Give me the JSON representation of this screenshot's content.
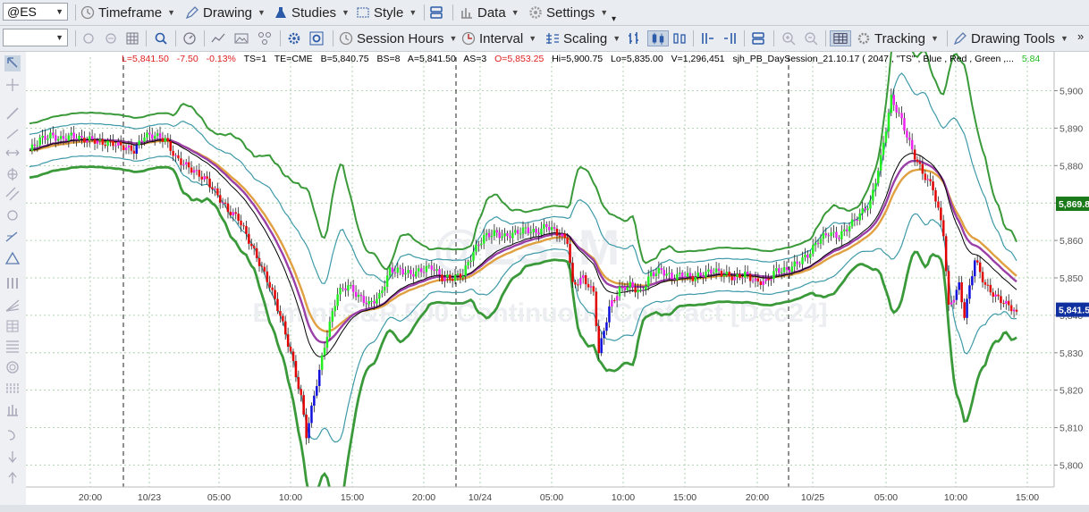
{
  "toolbar1": {
    "symbol": "@ES",
    "timeframe": "Timeframe",
    "drawing": "Drawing",
    "studies": "Studies",
    "style": "Style",
    "data": "Data",
    "settings": "Settings"
  },
  "toolbar2": {
    "combo_value": "",
    "session_hours": "Session Hours",
    "interval": "Interval",
    "scaling": "Scaling",
    "tracking": "Tracking",
    "drawing_tools": "Drawing Tools",
    "overflow": "»"
  },
  "status": {
    "last": "L=5,841.50",
    "change": "-7.50",
    "pct": "-0.13%",
    "ts": "TS=1",
    "te": "TE=CME",
    "bid": "B=5,840.75",
    "bs": "BS=8",
    "ask": "A=5,841.50",
    "as": "AS=3",
    "open": "O=5,853.25",
    "hi": "Hi=5,900.75",
    "lo": "Lo=5,835.00",
    "vol": "V=1,296,451",
    "study": "sjh_PB_DaySession_21.10.17 ( 2047 , \"TS\" , Blue , Red , Green ,...",
    "trail": "5.84"
  },
  "watermark": {
    "symbol": "@ES=M",
    "desc": "E-mini S&P 500 Continuous Contract [Dec24]"
  },
  "price_axis": {
    "ticks": [
      "5,900",
      "5,890",
      "5,880",
      "5,870",
      "5,860",
      "5,850",
      "5,840",
      "5,830",
      "5,820",
      "5,810",
      "5,800"
    ],
    "marker_green": "5,869.8",
    "marker_blue": "5,841.5"
  },
  "time_axis": {
    "labels": [
      "20:00",
      "10/23",
      "05:00",
      "10:00",
      "15:00",
      "20:00",
      "10/24",
      "05:00",
      "10:00",
      "15:00",
      "20:00",
      "10/25",
      "05:00",
      "10:00",
      "15:00"
    ]
  },
  "colors": {
    "up": "#22ee22",
    "down": "#ee1111",
    "strong_up": "#1010dd",
    "strong_down": "#e00000",
    "pullback": "#ee22ee",
    "band_outer": "#3a9a3a",
    "band_inner": "#3e9aa8",
    "avg_purple": "#9a3ea8",
    "avg_orange": "#e0a040",
    "avg_black": "#000000",
    "marker_green": "#1a7a1a",
    "marker_blue": "#1030a0"
  },
  "chart_data": {
    "type": "candlestick",
    "symbol": "@ES",
    "ylim": [
      5797,
      5907
    ],
    "session_breaks": [
      "10/23",
      "10/24",
      "10/25"
    ],
    "close_path": [
      [
        0,
        5884
      ],
      [
        4,
        5887
      ],
      [
        8,
        5888
      ],
      [
        12,
        5887
      ],
      [
        16,
        5888
      ],
      [
        20,
        5887
      ],
      [
        24,
        5887
      ],
      [
        28,
        5886
      ],
      [
        32,
        5886
      ],
      [
        36,
        5885
      ],
      [
        40,
        5884
      ],
      [
        44,
        5888
      ],
      [
        48,
        5888
      ],
      [
        52,
        5887
      ],
      [
        56,
        5882
      ],
      [
        60,
        5880
      ],
      [
        64,
        5878
      ],
      [
        68,
        5876
      ],
      [
        72,
        5872
      ],
      [
        76,
        5868
      ],
      [
        80,
        5866
      ],
      [
        84,
        5860
      ],
      [
        88,
        5854
      ],
      [
        92,
        5848
      ],
      [
        96,
        5840
      ],
      [
        100,
        5830
      ],
      [
        104,
        5818
      ],
      [
        106,
        5808
      ],
      [
        110,
        5822
      ],
      [
        114,
        5835
      ],
      [
        118,
        5846
      ],
      [
        122,
        5848
      ],
      [
        126,
        5845
      ],
      [
        130,
        5843
      ],
      [
        134,
        5845
      ],
      [
        138,
        5852
      ],
      [
        142,
        5852
      ],
      [
        146,
        5851
      ],
      [
        150,
        5852
      ],
      [
        154,
        5853
      ],
      [
        158,
        5850
      ],
      [
        162,
        5850
      ],
      [
        166,
        5851
      ],
      [
        170,
        5857
      ],
      [
        174,
        5861
      ],
      [
        178,
        5862
      ],
      [
        182,
        5861
      ],
      [
        186,
        5862
      ],
      [
        190,
        5863
      ],
      [
        194,
        5862
      ],
      [
        198,
        5864
      ],
      [
        202,
        5862
      ],
      [
        206,
        5860
      ],
      [
        208,
        5848
      ],
      [
        212,
        5850
      ],
      [
        216,
        5846
      ],
      [
        218,
        5830
      ],
      [
        222,
        5842
      ],
      [
        226,
        5847
      ],
      [
        230,
        5848
      ],
      [
        234,
        5846
      ],
      [
        238,
        5851
      ],
      [
        242,
        5852
      ],
      [
        246,
        5850
      ],
      [
        250,
        5851
      ],
      [
        254,
        5850
      ],
      [
        258,
        5851
      ],
      [
        262,
        5852
      ],
      [
        266,
        5851
      ],
      [
        270,
        5850
      ],
      [
        274,
        5851
      ],
      [
        278,
        5849
      ],
      [
        282,
        5849
      ],
      [
        286,
        5852
      ],
      [
        290,
        5852
      ],
      [
        294,
        5854
      ],
      [
        298,
        5856
      ],
      [
        302,
        5860
      ],
      [
        306,
        5862
      ],
      [
        310,
        5861
      ],
      [
        314,
        5864
      ],
      [
        318,
        5867
      ],
      [
        322,
        5870
      ],
      [
        326,
        5882
      ],
      [
        330,
        5898
      ],
      [
        334,
        5892
      ],
      [
        338,
        5884
      ],
      [
        342,
        5878
      ],
      [
        346,
        5874
      ],
      [
        350,
        5862
      ],
      [
        352,
        5842
      ],
      [
        356,
        5848
      ],
      [
        358,
        5840
      ],
      [
        362,
        5855
      ],
      [
        366,
        5848
      ],
      [
        370,
        5845
      ],
      [
        374,
        5843
      ],
      [
        378,
        5841
      ]
    ]
  }
}
